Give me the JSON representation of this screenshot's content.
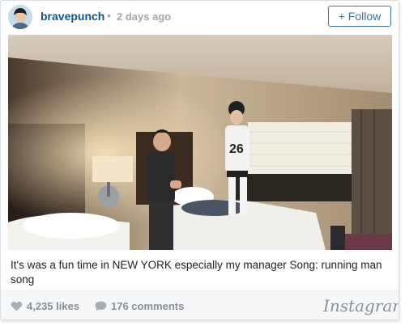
{
  "post": {
    "username": "bravepunch",
    "separator": "•",
    "time_ago": "2 days ago",
    "follow_label": "+ Follow",
    "caption": "It's was a fun time in NEW YORK especially my manager Song: running man song",
    "likes": "4,235 likes",
    "comments": "176 comments",
    "brand": "Instagram"
  },
  "icons": {
    "like": "heart-icon",
    "comment": "comment-bubble-icon"
  },
  "colors": {
    "username": "#125688",
    "follow_button": "#3f729b",
    "meta_gray": "#8a8f94"
  }
}
